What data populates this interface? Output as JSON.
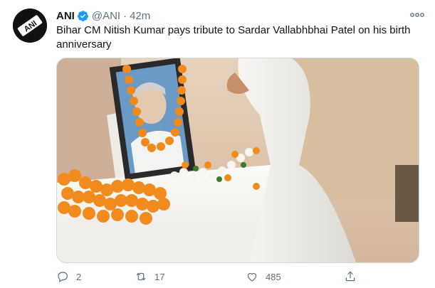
{
  "tweet": {
    "author_name": "ANI",
    "handle": "@ANI",
    "separator": "·",
    "time": "42m",
    "text": "Bihar CM Nitish Kumar pays tribute to Sardar Vallabhbhai Patel on his birth anniversary",
    "avatar_text": "ANI",
    "image_icon": "photo-tribute-image",
    "accent_color": "#1d9bf0"
  },
  "actions": {
    "reply_count": "2",
    "retweet_count": "17",
    "like_count": "485"
  }
}
